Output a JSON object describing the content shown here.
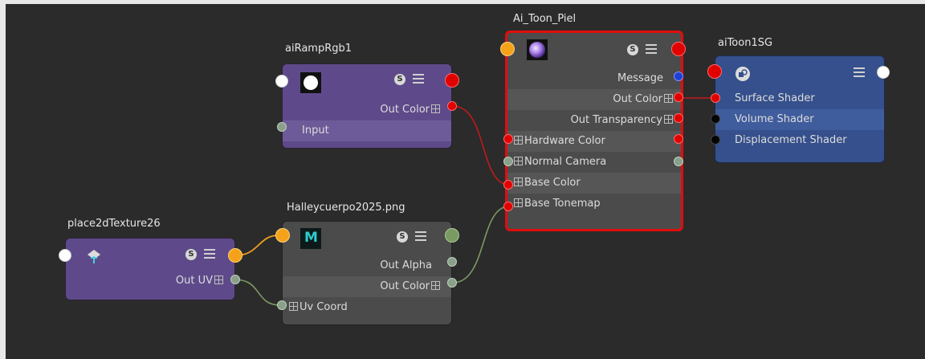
{
  "nodes": {
    "ramp": {
      "title": "aiRampRgb1",
      "out_color": "Out Color",
      "input": "Input",
      "s_label": "S"
    },
    "place2d": {
      "title": "place2dTexture26",
      "out_uv": "Out UV",
      "s_label": "S"
    },
    "texture": {
      "title": "Halleycuerpo2025.png",
      "thumb_letter": "M",
      "out_alpha": "Out Alpha",
      "out_color": "Out Color",
      "uv_coord": "Uv Coord",
      "s_label": "S"
    },
    "toon": {
      "title": "Ai_Toon_Piel",
      "message": "Message",
      "out_color": "Out Color",
      "out_transparency": "Out Transparency",
      "hardware_color": "Hardware Color",
      "normal_camera": "Normal Camera",
      "base_color": "Base Color",
      "base_tonemap": "Base Tonemap",
      "s_label": "S"
    },
    "sg": {
      "title": "aiToon1SG",
      "surface_shader": "Surface Shader",
      "volume_shader": "Volume Shader",
      "displacement_shader": "Displacement Shader"
    }
  },
  "colors": {
    "background": "#2b2b2b",
    "purple_node": "#5e4a8a",
    "grey_node": "#4b4b4b",
    "blue_node": "#35508c",
    "selected_outline": "#e00d0d",
    "wire_red": "#c21a1a",
    "wire_orange": "#f0a020",
    "wire_green": "#7c9a64"
  },
  "icons": {
    "ramp_swatch": "white-circle-icon",
    "place2d": "place2d-texture-icon",
    "texture": "maya-file-icon",
    "toon": "purple-sphere-icon",
    "sg": "shading-group-icon",
    "menu": "hamburger-menu-icon",
    "s_badge": "swatch-badge-icon"
  }
}
